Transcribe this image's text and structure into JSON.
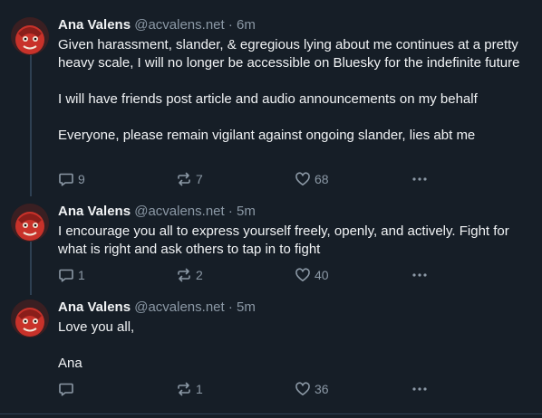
{
  "colors": {
    "background": "#161e27",
    "text_primary": "#f1f3f5",
    "text_secondary": "#8b98a5",
    "divider": "#2e4052",
    "avatar_accent": "#c8322a"
  },
  "posts": [
    {
      "author_name": "Ana Valens",
      "author_handle": "@acvalens.net",
      "separator": "·",
      "time": "6m",
      "paragraphs": [
        "Given harassment, slander, & egregious lying about me continues at a pretty heavy scale, I will no longer be accessible on Bluesky for the indefinite future",
        "I will have friends post article and audio announcements on my behalf",
        "Everyone, please remain vigilant against ongoing slander, lies abt me"
      ],
      "reply_count": "9",
      "repost_count": "7",
      "like_count": "68",
      "icons": {
        "reply": "reply-icon",
        "repost": "repost-icon",
        "like": "heart-icon",
        "more": "more-icon"
      }
    },
    {
      "author_name": "Ana Valens",
      "author_handle": "@acvalens.net",
      "separator": "·",
      "time": "5m",
      "paragraphs": [
        "I encourage you all to express yourself freely, openly, and actively. Fight for what is right and ask others to tap in to fight"
      ],
      "reply_count": "1",
      "repost_count": "2",
      "like_count": "40",
      "icons": {
        "reply": "reply-icon",
        "repost": "repost-icon",
        "like": "heart-icon",
        "more": "more-icon"
      }
    },
    {
      "author_name": "Ana Valens",
      "author_handle": "@acvalens.net",
      "separator": "·",
      "time": "5m",
      "paragraphs": [
        "Love you all,",
        "Ana"
      ],
      "reply_count": "",
      "repost_count": "1",
      "like_count": "36",
      "icons": {
        "reply": "reply-icon",
        "repost": "repost-icon",
        "like": "heart-icon",
        "more": "more-icon"
      }
    }
  ]
}
